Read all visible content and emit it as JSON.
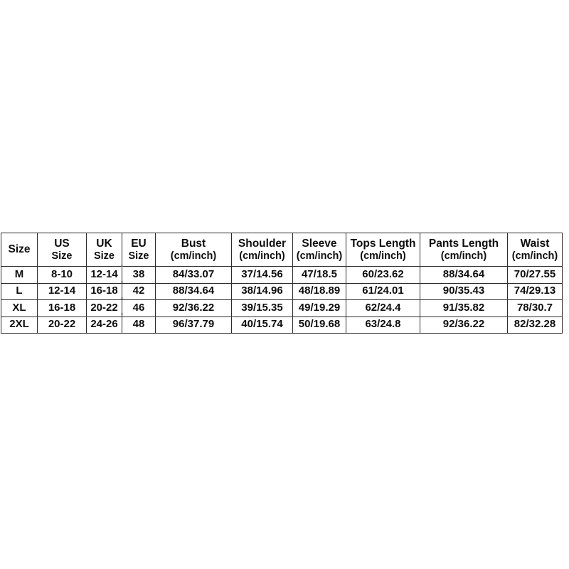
{
  "chart_data": {
    "type": "table",
    "title": "",
    "columns": [
      {
        "line1": "Size",
        "line2": "",
        "single_line": true
      },
      {
        "line1": "US",
        "line2": "Size",
        "single_line": false
      },
      {
        "line1": "UK",
        "line2": "Size",
        "single_line": false
      },
      {
        "line1": "EU",
        "line2": "Size",
        "single_line": false
      },
      {
        "line1": "Bust",
        "line2": "(cm/inch)",
        "single_line": false
      },
      {
        "line1": "Shoulder",
        "line2": "(cm/inch)",
        "single_line": false
      },
      {
        "line1": "Sleeve",
        "line2": "(cm/inch)",
        "single_line": false
      },
      {
        "line1": "Tops Length",
        "line2": "(cm/inch)",
        "single_line": false
      },
      {
        "line1": "Pants Length",
        "line2": "(cm/inch)",
        "single_line": false
      },
      {
        "line1": "Waist",
        "line2": "(cm/inch)",
        "single_line": false
      }
    ],
    "rows": [
      {
        "size": "M",
        "us_size": "8-10",
        "uk_size": "12-14",
        "eu_size": "38",
        "bust": "84/33.07",
        "shoulder": "37/14.56",
        "sleeve": "47/18.5",
        "tops_length": "60/23.62",
        "pants_length": "88/34.64",
        "waist": "70/27.55"
      },
      {
        "size": "L",
        "us_size": "12-14",
        "uk_size": "16-18",
        "eu_size": "42",
        "bust": "88/34.64",
        "shoulder": "38/14.96",
        "sleeve": "48/18.89",
        "tops_length": "61/24.01",
        "pants_length": "90/35.43",
        "waist": "74/29.13"
      },
      {
        "size": "XL",
        "us_size": "16-18",
        "uk_size": "20-22",
        "eu_size": "46",
        "bust": "92/36.22",
        "shoulder": "39/15.35",
        "sleeve": "49/19.29",
        "tops_length": "62/24.4",
        "pants_length": "91/35.82",
        "waist": "78/30.7"
      },
      {
        "size": "2XL",
        "us_size": "20-22",
        "uk_size": "24-26",
        "eu_size": "48",
        "bust": "96/37.79",
        "shoulder": "40/15.74",
        "sleeve": "50/19.68",
        "tops_length": "63/24.8",
        "pants_length": "92/36.22",
        "waist": "82/32.28"
      }
    ],
    "colors": {
      "background": "#ffffff",
      "text": "#0d0d0d",
      "border": "#2b2b2b"
    }
  }
}
